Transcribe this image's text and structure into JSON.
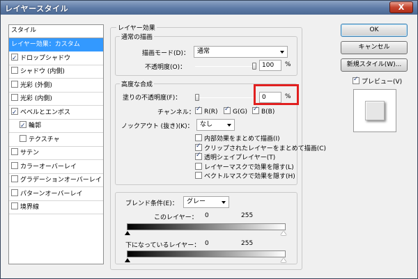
{
  "window": {
    "title": "レイヤースタイル",
    "close_label": "X"
  },
  "sidebar": {
    "header": "スタイル",
    "items": [
      {
        "label": "レイヤー効果：カスタム",
        "checkbox": false,
        "checked": false,
        "selected": true,
        "indent": 0
      },
      {
        "label": "ドロップシャドウ",
        "checkbox": true,
        "checked": true,
        "selected": false,
        "indent": 0
      },
      {
        "label": "シャドウ (内側)",
        "checkbox": true,
        "checked": false,
        "selected": false,
        "indent": 0
      },
      {
        "label": "光彩 (外側)",
        "checkbox": true,
        "checked": false,
        "selected": false,
        "indent": 0
      },
      {
        "label": "光彩 (内側)",
        "checkbox": true,
        "checked": false,
        "selected": false,
        "indent": 0
      },
      {
        "label": "ベベルとエンボス",
        "checkbox": true,
        "checked": true,
        "selected": false,
        "indent": 0
      },
      {
        "label": "輪郭",
        "checkbox": true,
        "checked": true,
        "selected": false,
        "indent": 1
      },
      {
        "label": "テクスチャ",
        "checkbox": true,
        "checked": false,
        "selected": false,
        "indent": 1
      },
      {
        "label": "サテン",
        "checkbox": true,
        "checked": false,
        "selected": false,
        "indent": 0
      },
      {
        "label": "カラーオーバーレイ",
        "checkbox": true,
        "checked": false,
        "selected": false,
        "indent": 0
      },
      {
        "label": "グラデーションオーバーレイ",
        "checkbox": true,
        "checked": false,
        "selected": false,
        "indent": 0
      },
      {
        "label": "パターンオーバーレイ",
        "checkbox": true,
        "checked": false,
        "selected": false,
        "indent": 0
      },
      {
        "label": "境界線",
        "checkbox": true,
        "checked": false,
        "selected": false,
        "indent": 0
      }
    ]
  },
  "main": {
    "section_title": "レイヤー効果",
    "general": {
      "title": "通常の描画",
      "blend_mode_label": "描画モード(D)：",
      "blend_mode_value": "通常",
      "opacity_label": "不透明度(O)：",
      "opacity_value": "100",
      "opacity_unit": "%",
      "opacity_level_percent": 100
    },
    "advanced": {
      "title": "高度な合成",
      "fill_opacity_label": "塗りの不透明度(F)：",
      "fill_opacity_value": "0",
      "fill_opacity_unit": "%",
      "fill_opacity_level_percent": 0,
      "channels_label": "チャンネル：",
      "channel_r": "R(R)",
      "channel_g": "G(G)",
      "channel_b": "B(B)",
      "knockout_label": "ノックアウト (抜き)(K)：",
      "knockout_value": "なし",
      "options": [
        {
          "label": "内部効果をまとめて描画(I)",
          "checked": false
        },
        {
          "label": "クリップされたレイヤーをまとめて描画(C)",
          "checked": true
        },
        {
          "label": "透明シェイプレイヤー(T)",
          "checked": true
        },
        {
          "label": "レイヤーマスクで効果を隠す(L)",
          "checked": false
        },
        {
          "label": "ベクトルマスクで効果を隠す(H)",
          "checked": false
        }
      ]
    },
    "blend_if": {
      "label": "ブレンド条件(E)：",
      "value": "グレー",
      "this_layer_label": "このレイヤー：",
      "this_layer_min": "0",
      "this_layer_max": "255",
      "underlying_label": "下になっているレイヤー：",
      "underlying_min": "0",
      "underlying_max": "255"
    }
  },
  "buttons": {
    "ok": "OK",
    "cancel": "キャンセル",
    "new_style": "新規スタイル(W)...",
    "preview_label": "プレビュー(V)",
    "preview_checked": true
  },
  "colors": {
    "selection": "#3399ff",
    "highlight_box": "#e12020",
    "title_bar": "#5d7aa6"
  }
}
